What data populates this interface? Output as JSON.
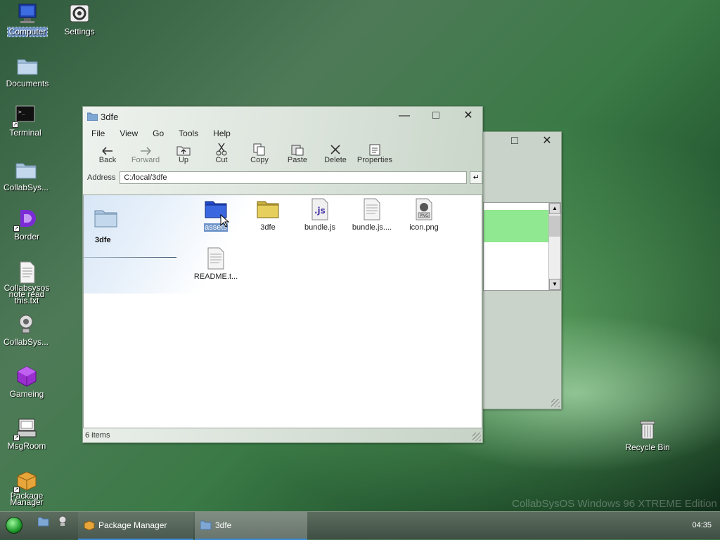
{
  "desktop": {
    "icons": [
      {
        "label": "Computer",
        "icon": "computer-icon"
      },
      {
        "label": "Settings",
        "icon": "settings-icon"
      },
      {
        "label": "Documents",
        "icon": "folder-icon"
      },
      {
        "label": "Terminal",
        "icon": "terminal-icon"
      },
      {
        "label": "CollabSys...",
        "icon": "folder-icon"
      },
      {
        "label": "Border",
        "icon": "border-app-icon"
      },
      {
        "label": "Collabsysos note read this.txt",
        "icon": "text-file-icon"
      },
      {
        "label": "CollabSys...",
        "icon": "webcam-icon"
      },
      {
        "label": "Gameing",
        "icon": "cube-icon"
      },
      {
        "label": "MsgRoom",
        "icon": "msgroom-icon"
      },
      {
        "label": "Package Manager",
        "icon": "package-icon"
      },
      {
        "label": "Recycle Bin",
        "icon": "recycle-bin-icon"
      }
    ],
    "watermark": "CollabSysOS Windows 96 XTREME Edition"
  },
  "explorer": {
    "title": "3dfe",
    "menu": [
      "File",
      "View",
      "Go",
      "Tools",
      "Help"
    ],
    "toolbar": [
      "Back",
      "Forward",
      "Up",
      "Cut",
      "Copy",
      "Paste",
      "Delete",
      "Properties"
    ],
    "address_label": "Address",
    "address_value": "C:/local/3dfe",
    "go_symbol": "↵",
    "sidebar_folder": "3dfe",
    "files": [
      {
        "name": "assets",
        "type": "folder-blue"
      },
      {
        "name": "3dfe",
        "type": "folder-yellow"
      },
      {
        "name": "bundle.js",
        "type": "js"
      },
      {
        "name": "bundle.js....",
        "type": "doc"
      },
      {
        "name": "icon.png",
        "type": "png"
      },
      {
        "name": "README.t...",
        "type": "doc"
      }
    ],
    "status": "6 items"
  },
  "taskbar": {
    "tasks": [
      "Package Manager",
      "3dfe"
    ],
    "clock": "04:35"
  },
  "colors": {
    "accent_green": "#90e890",
    "selection_blue": "#6f95c9"
  }
}
